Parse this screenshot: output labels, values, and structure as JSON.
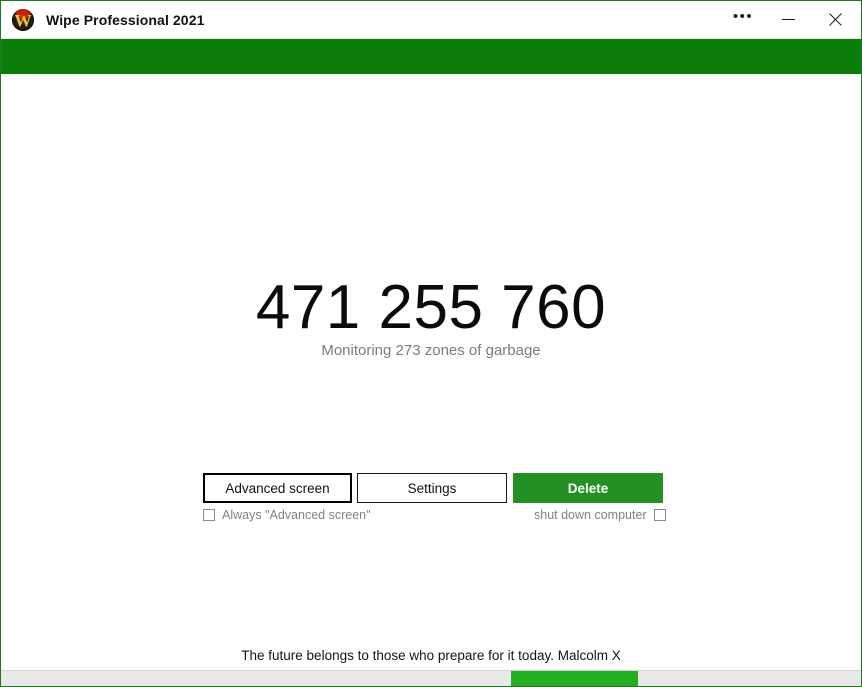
{
  "window": {
    "title": "Wipe Professional 2021",
    "app_icon": "app-logo-icon",
    "logo_letter": "W",
    "border_color": "#1f7a1f",
    "accent_color": "#0b7d0b"
  },
  "titlebar": {
    "more_label": "•••",
    "more_name": "more-options-icon",
    "minimize_name": "minimize-icon",
    "close_name": "close-icon"
  },
  "main": {
    "counter_value": "471 255 760",
    "counter_subtitle": "Monitoring 273 zones of garbage"
  },
  "buttons": {
    "advanced_label": "Advanced screen",
    "settings_label": "Settings",
    "delete_label": "Delete",
    "delete_color": "#239023"
  },
  "options": {
    "always_advanced_label": "Always \"Advanced screen\"",
    "always_advanced_checked": false,
    "shutdown_label": "shut down computer",
    "shutdown_checked": false
  },
  "footer": {
    "quote": "The future belongs to those who prepare for it today. Malcolm X"
  },
  "progress": {
    "thumb_color": "#22b022",
    "track_color": "#e9e9e9"
  }
}
